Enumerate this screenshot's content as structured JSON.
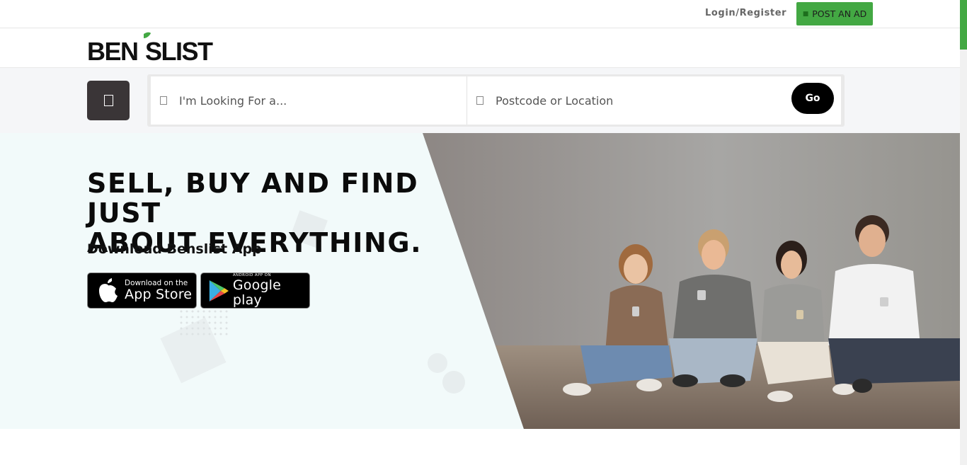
{
  "header": {
    "login_register": "Login/Register",
    "post_ad_label": "POST AN AD"
  },
  "brand": {
    "logo_text_left": "BEN",
    "logo_text_right": "SLIST",
    "accent_color": "#43a843"
  },
  "search": {
    "menu_icon": "menu-icon",
    "keyword_placeholder": "I'm Looking For a...",
    "location_placeholder": "Postcode or Location",
    "go_label": "Go"
  },
  "hero": {
    "headline_line1": "SELL, BUY AND FIND JUST",
    "headline_line2": "ABOUT EVERYTHING.",
    "subheading": "Download Benslist App",
    "app_store": {
      "small": "Download on the",
      "big": "App Store"
    },
    "google_play": {
      "tiny": "ANDROID APP ON",
      "big": "Google play"
    }
  }
}
